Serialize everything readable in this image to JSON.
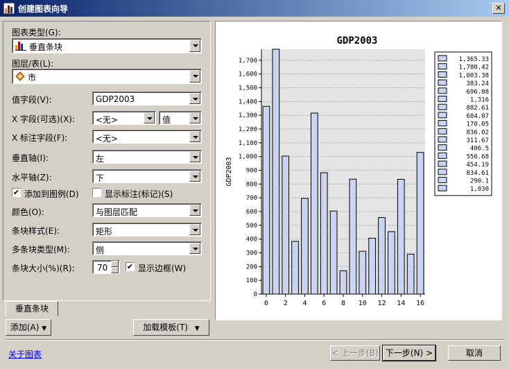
{
  "window": {
    "title": "创建图表向导",
    "close_label": "✕"
  },
  "form": {
    "chart_type_label": "图表类型(G):",
    "chart_type_value": "垂直条块",
    "layer_label": "图层/表(L):",
    "layer_value": "市",
    "value_field_label": "值字段(V):",
    "value_field_value": "GDP2003",
    "x_field_label": "X 字段(可选)(X):",
    "x_field_value": "<无>",
    "x_field_type_value": "值",
    "x_label_field_label": "X 标注字段(F):",
    "x_label_field_value": "<无>",
    "vertical_axis_label": "垂直轴(I):",
    "vertical_axis_value": "左",
    "horizontal_axis_label": "水平轴(Z):",
    "horizontal_axis_value": "下",
    "add_to_legend_label": "添加到图例(D)",
    "add_to_legend_checked": true,
    "show_labels_label": "显示标注(标记)(S)",
    "show_labels_checked": false,
    "color_label": "颜色(O):",
    "color_value": "与图层匹配",
    "bar_style_label": "条块样式(E):",
    "bar_style_value": "矩形",
    "multi_bar_type_label": "多条块类型(M):",
    "multi_bar_type_value": "侧",
    "bar_size_label": "条块大小(%)(R):",
    "bar_size_value": "70",
    "show_border_label": "显示边框(W)",
    "show_border_checked": true
  },
  "tabs": [
    {
      "label": "垂直条块"
    }
  ],
  "buttons": {
    "add_label": "添加(A)",
    "load_template_label": "加载模板(T)",
    "back_label": "< 上一步(B)",
    "next_label": "下一步(N) >",
    "cancel_label": "取消"
  },
  "footer": {
    "about_link": "关于图表"
  },
  "colors": {
    "bar_fill": "#c8d4f0",
    "bar_stroke": "#000000",
    "plot_bg": "#e4e4e4",
    "title_bar_start": "#0a246a",
    "title_bar_end": "#a6caf0"
  },
  "chart_data": {
    "type": "bar",
    "title": "GDP2003",
    "ylabel": "GDP2003",
    "xlabel": "",
    "x": [
      0,
      1,
      2,
      3,
      4,
      5,
      6,
      7,
      8,
      9,
      10,
      11,
      12,
      13,
      14,
      15,
      16
    ],
    "values": [
      1365.33,
      1780.42,
      1003.38,
      383.24,
      696.08,
      1316,
      882.61,
      604.07,
      170.05,
      836.02,
      311.67,
      406.5,
      556.68,
      454.19,
      834.61,
      290.1,
      1030
    ],
    "xlim": [
      -0.5,
      16.5
    ],
    "ylim": [
      0,
      1780
    ],
    "yticks": [
      0,
      100,
      200,
      300,
      400,
      500,
      600,
      700,
      800,
      900,
      1000,
      1100,
      1200,
      1300,
      1400,
      1500,
      1600,
      1700
    ],
    "ytick_labels": [
      "0",
      "100",
      "200",
      "300",
      "400",
      "500",
      "600",
      "700",
      "800",
      "900",
      "1,000",
      "1,100",
      "1,200",
      "1,300",
      "1,400",
      "1,500",
      "1,600",
      "1,700"
    ],
    "xticks": [
      0,
      2,
      4,
      6,
      8,
      10,
      12,
      14,
      16
    ],
    "xtick_labels": [
      "0",
      "2",
      "4",
      "6",
      "8",
      "10",
      "12",
      "14",
      "16"
    ],
    "legend_labels": [
      "1,365.33",
      "1,780.42",
      "1,003.38",
      "383.24",
      "696.08",
      "1,316",
      "882.61",
      "604.07",
      "170.05",
      "836.02",
      "311.67",
      "406.5",
      "556.68",
      "454.19",
      "834.61",
      "290.1",
      "1,030"
    ],
    "legend_position": "right",
    "grid": "horizontal"
  }
}
